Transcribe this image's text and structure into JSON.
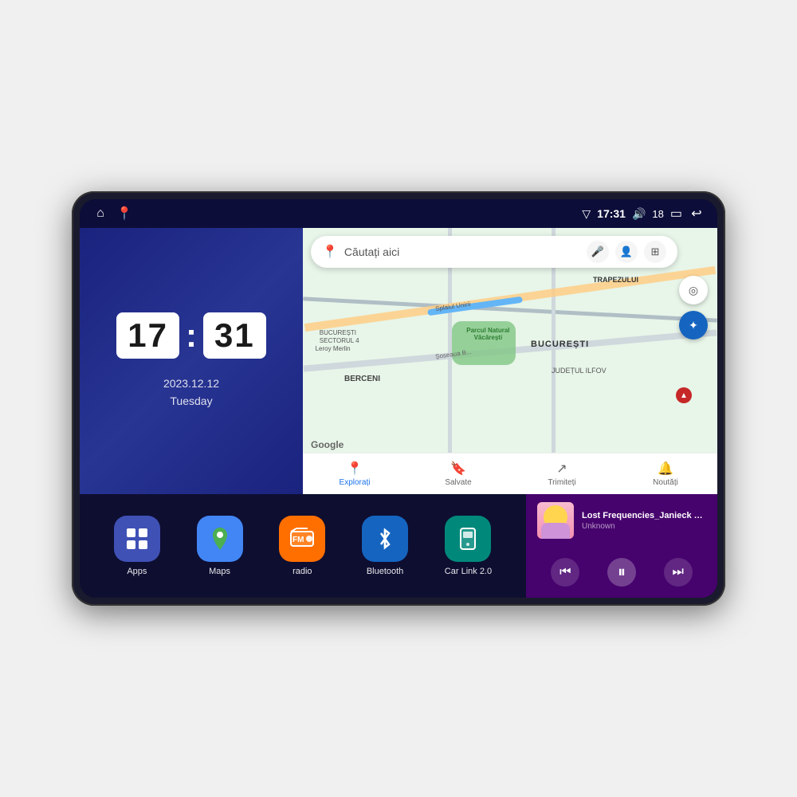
{
  "device": {
    "screen": {
      "status_bar": {
        "nav_icon_home": "⌂",
        "nav_icon_maps": "📍",
        "signal_icon": "▽",
        "time": "17:31",
        "volume_icon": "🔊",
        "volume_level": "18",
        "battery_icon": "▭",
        "back_icon": "↩"
      },
      "clock_widget": {
        "hour": "17",
        "minute": "31",
        "date": "2023.12.12",
        "day": "Tuesday"
      },
      "map_widget": {
        "search_placeholder": "Căutați aici",
        "mic_icon": "🎤",
        "account_icon": "👤",
        "layers_icon": "⊞",
        "location_icon": "◎",
        "compass_icon": "🧭",
        "google_logo": "Google",
        "nav_items": [
          {
            "id": "explorare",
            "label": "Explorați",
            "icon": "📍",
            "active": true
          },
          {
            "id": "salvate",
            "label": "Salvate",
            "icon": "🔖",
            "active": false
          },
          {
            "id": "trimiteti",
            "label": "Trimiteți",
            "icon": "↗",
            "active": false
          },
          {
            "id": "noutati",
            "label": "Noutăți",
            "icon": "🔔",
            "active": false
          }
        ],
        "map_labels": {
          "bucuresti": "BUCUREȘTI",
          "judetul_ilfov": "JUDEȚUL ILFOV",
          "trapezului": "TRAPEZULUI",
          "berceni": "BERCENI",
          "bucuresti_sector": "BUCUREȘTI\nSECTORUL 4",
          "parcul": "Parcul Natural Văcărești",
          "leroy": "Leroy Merlin",
          "soseaua": "Șoseaua B..."
        }
      },
      "app_launcher": {
        "apps": [
          {
            "id": "apps",
            "label": "Apps",
            "icon": "⊞",
            "bg": "apps"
          },
          {
            "id": "maps",
            "label": "Maps",
            "icon": "🗺",
            "bg": "maps"
          },
          {
            "id": "radio",
            "label": "radio",
            "icon": "📻",
            "bg": "radio"
          },
          {
            "id": "bluetooth",
            "label": "Bluetooth",
            "icon": "ʙ",
            "bg": "bluetooth"
          },
          {
            "id": "carlink",
            "label": "Car Link 2.0",
            "icon": "📱",
            "bg": "carlink"
          }
        ]
      },
      "music_player": {
        "title": "Lost Frequencies_Janieck Devy-...",
        "artist": "Unknown",
        "prev_icon": "⏮",
        "play_icon": "⏸",
        "next_icon": "⏭"
      }
    }
  }
}
